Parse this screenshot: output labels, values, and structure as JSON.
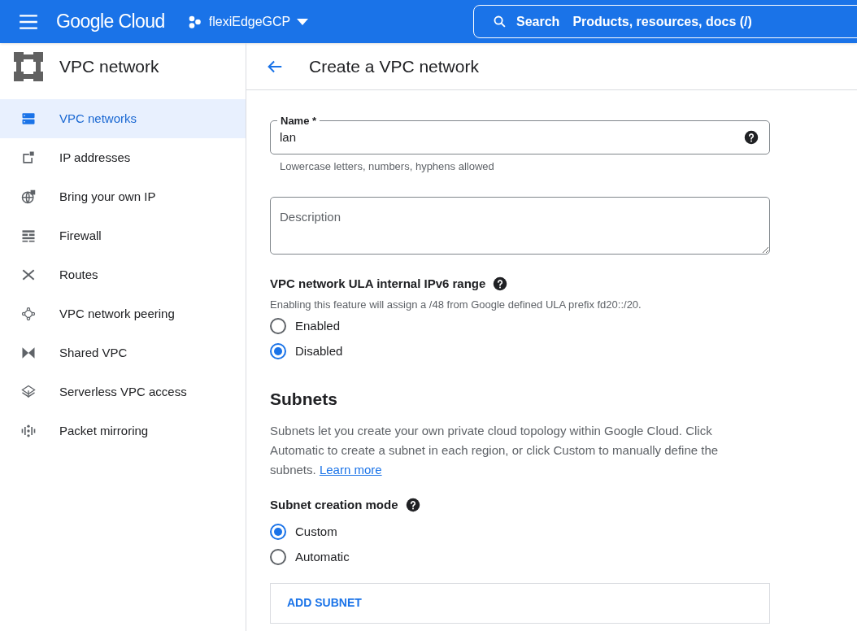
{
  "header": {
    "brand": "Google Cloud",
    "project": "flexiEdgeGCP",
    "search": {
      "label": "Search",
      "placeholder": "Products, resources, docs (/)"
    }
  },
  "sidebar": {
    "title": "VPC network",
    "items": [
      {
        "label": "VPC networks",
        "selected": true
      },
      {
        "label": "IP addresses",
        "selected": false
      },
      {
        "label": "Bring your own IP",
        "selected": false
      },
      {
        "label": "Firewall",
        "selected": false
      },
      {
        "label": "Routes",
        "selected": false
      },
      {
        "label": "VPC network peering",
        "selected": false
      },
      {
        "label": "Shared VPC",
        "selected": false
      },
      {
        "label": "Serverless VPC access",
        "selected": false
      },
      {
        "label": "Packet mirroring",
        "selected": false
      }
    ]
  },
  "page": {
    "title": "Create a VPC network",
    "name_field": {
      "label": "Name *",
      "value": "lan",
      "hint": "Lowercase letters, numbers, hyphens allowed"
    },
    "description_field": {
      "placeholder": "Description"
    },
    "ula": {
      "title": "VPC network ULA internal IPv6 range",
      "text": "Enabling this feature will assign a /48 from Google defined ULA prefix fd20::/20.",
      "options": [
        {
          "label": "Enabled",
          "selected": false
        },
        {
          "label": "Disabled",
          "selected": true
        }
      ]
    },
    "subnets": {
      "title": "Subnets",
      "text": "Subnets let you create your own private cloud topology within Google Cloud. Click Automatic to create a subnet in each region, or click Custom to manually define the subnets.",
      "link": "Learn more",
      "mode_title": "Subnet creation mode",
      "options": [
        {
          "label": "Custom",
          "selected": true
        },
        {
          "label": "Automatic",
          "selected": false
        }
      ],
      "add_button": "ADD SUBNET"
    }
  }
}
